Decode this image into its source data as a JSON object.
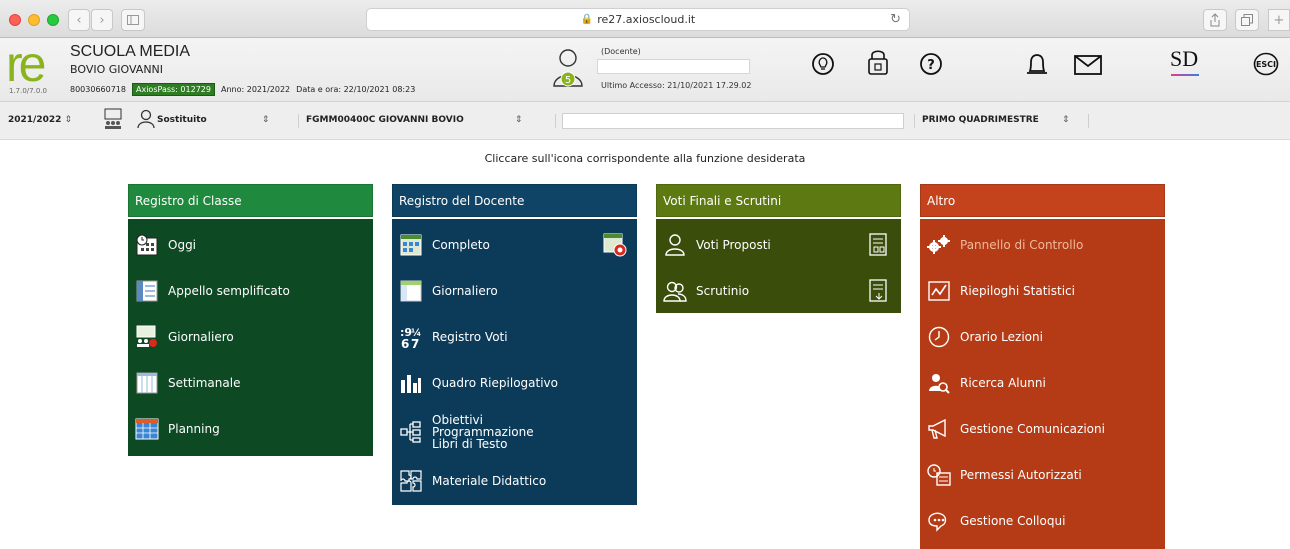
{
  "browser": {
    "url": "re27.axioscloud.it"
  },
  "header": {
    "logo": "re",
    "version": "1.7.0/7.0.0",
    "school_name": "SCUOLA MEDIA",
    "school_subname": "BOVIO GIOVANNI",
    "code": "80030660718",
    "axiospass": "AxiosPass: 012729",
    "year_info": "Anno: 2021/2022",
    "datetime": "Data e ora: 22/10/2021 08:23",
    "user_badge": "5",
    "role": "(Docente)",
    "last_access": "Ultimo Accesso: 21/10/2021 17.29.02",
    "sd_label": "SD",
    "esci_label": "ESCI"
  },
  "toolbar": {
    "year": "2021/2022",
    "role_select": "Sostituito",
    "school_select": "FGMM00400C GIOVANNI BOVIO",
    "period_select": "PRIMO QUADRIMESTRE"
  },
  "instruction": "Cliccare sull'icona corrispondente alla funzione desiderata",
  "panels": {
    "classe": {
      "title": "Registro di Classe",
      "head_color": "#1f8a3e",
      "body_color": "#0d4a24",
      "items": [
        "Oggi",
        "Appello semplificato",
        "Giornaliero",
        "Settimanale",
        "Planning"
      ]
    },
    "docente": {
      "title": "Registro del Docente",
      "head_color": "#0f4466",
      "body_color": "#0c3b5a",
      "items": [
        "Completo",
        "Giornaliero",
        "Registro Voti",
        "Quadro Riepilogativo",
        "Obiettivi\nProgrammazione\nLibri di Testo",
        "Materiale Didattico"
      ]
    },
    "voti": {
      "title": "Voti Finali e Scrutini",
      "head_color": "#5d7a12",
      "body_color": "#3a4d0a",
      "items": [
        "Voti Proposti",
        "Scrutinio"
      ]
    },
    "altro": {
      "title": "Altro",
      "head_color": "#c4431c",
      "body_color": "#b53b16",
      "items": [
        "Pannello di Controllo",
        "Riepiloghi Statistici",
        "Orario Lezioni",
        "Ricerca Alunni",
        "Gestione Comunicazioni",
        "Permessi Autorizzati",
        "Gestione Colloqui"
      ]
    }
  }
}
